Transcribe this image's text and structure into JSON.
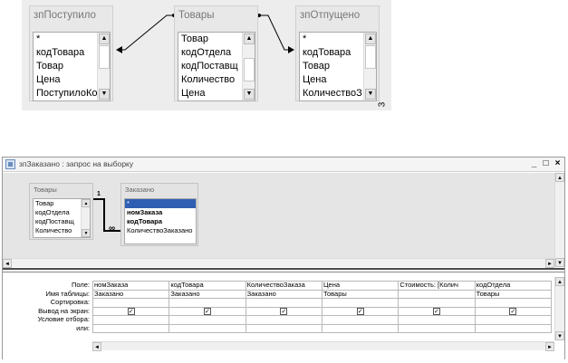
{
  "diagram": {
    "tables": [
      {
        "title": "зпПоступило",
        "items": [
          "*",
          "кодТовара",
          "Товар",
          "Цена",
          "ПоступилоКо"
        ]
      },
      {
        "title": "Товары",
        "items": [
          "Товар",
          "кодОтдела",
          "кодПоставщ",
          "Количество",
          "Цена"
        ]
      },
      {
        "title": "зпОтпущено",
        "items": [
          "*",
          "кодТовара",
          "Товар",
          "Цена",
          "КоличествоЗ"
        ]
      }
    ],
    "caption": "3"
  },
  "query_window": {
    "title": "зпЗаказано : запрос на выборку",
    "buttons": {
      "minimize": "_",
      "maximize": "□",
      "close": "×"
    },
    "tables": [
      {
        "title": "Товары",
        "items": [
          "Товар",
          "кодОтдела",
          "кодПоставщ",
          "Количество"
        ]
      },
      {
        "title": "Заказано",
        "items": [
          "*",
          "номЗаказа",
          "кодТовара",
          "КоличествоЗаказано"
        ]
      }
    ],
    "relation": {
      "one": "1",
      "many": "∞"
    },
    "grid": {
      "row_labels": [
        "Поле:",
        "Имя таблицы:",
        "Сортировка:",
        "Вывод на экран:",
        "Условие отбора:",
        "или:"
      ],
      "columns": [
        {
          "field": "номЗаказа",
          "table": "Заказано",
          "show": true
        },
        {
          "field": "кодТовара",
          "table": "Заказано",
          "show": true
        },
        {
          "field": "КоличествоЗаказа",
          "table": "Заказано",
          "show": true
        },
        {
          "field": "Цена",
          "table": "Товары",
          "show": true
        },
        {
          "field": "Стоимость: [Колич",
          "table": "",
          "show": true
        },
        {
          "field": "кодОтдела",
          "table": "Товары",
          "show": true
        }
      ],
      "check_glyph": "✓"
    },
    "scroll_glyphs": {
      "up": "▲",
      "down": "▼",
      "left": "◄",
      "right": "►"
    }
  }
}
